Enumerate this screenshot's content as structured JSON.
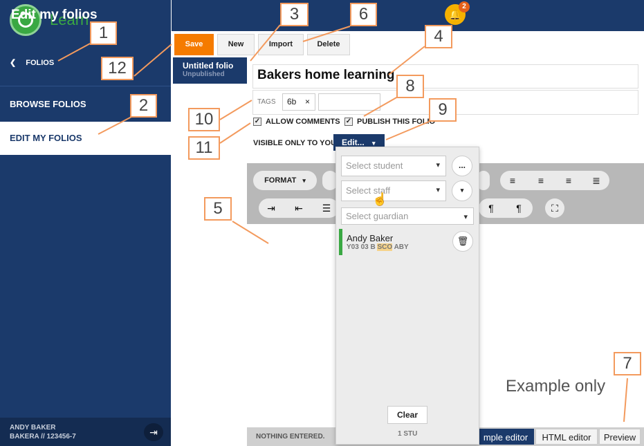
{
  "sidebar": {
    "logo_text": "Learn",
    "back_label": "FOLIOS",
    "browse_label": "BROWSE FOLIOS",
    "edit_label": "EDIT MY FOLIOS",
    "user_name": "ANDY BAKER",
    "user_id": "BAKERA // 123456-7"
  },
  "header": {
    "title": "Edit my folios",
    "notification_count": "2"
  },
  "toolbar": {
    "save": "Save",
    "new": "New",
    "import": "Import",
    "delete": "Delete"
  },
  "folio": {
    "name": "Untitled folio",
    "status": "Unpublished",
    "title_value": "Bakers home learning",
    "tags_label": "TAGS",
    "tag": "6b",
    "tag_remove": "×",
    "allow_comments": "ALLOW COMMENTS",
    "publish": "PUBLISH THIS FOLIO",
    "visibility": "VISIBLE ONLY TO YOU.",
    "edit_dropdown": "Edit..."
  },
  "editor": {
    "format_label": "FORMAT",
    "status_text": "NOTHING ENTERED.",
    "modes": [
      "mple editor",
      "HTML editor",
      "Preview"
    ]
  },
  "popup": {
    "student_placeholder": "Select student",
    "staff_placeholder": "Select staff",
    "guardian_placeholder": "Select guardian",
    "more_label": "...",
    "person_name": "Andy Baker",
    "person_info_pre": "Y03 03 B ",
    "person_info_hl": "SCO",
    "person_info_post": " ABY",
    "clear": "Clear",
    "count": "1 STU"
  },
  "annotation": {
    "example": "Example only",
    "callouts": [
      "1",
      "2",
      "3",
      "4",
      "5",
      "6",
      "7",
      "8",
      "9",
      "10",
      "11",
      "12"
    ]
  },
  "colors": {
    "navy": "#1b3a6b",
    "green": "#3aa843",
    "orange": "#f57b00",
    "callout_border": "#f39a5d"
  }
}
